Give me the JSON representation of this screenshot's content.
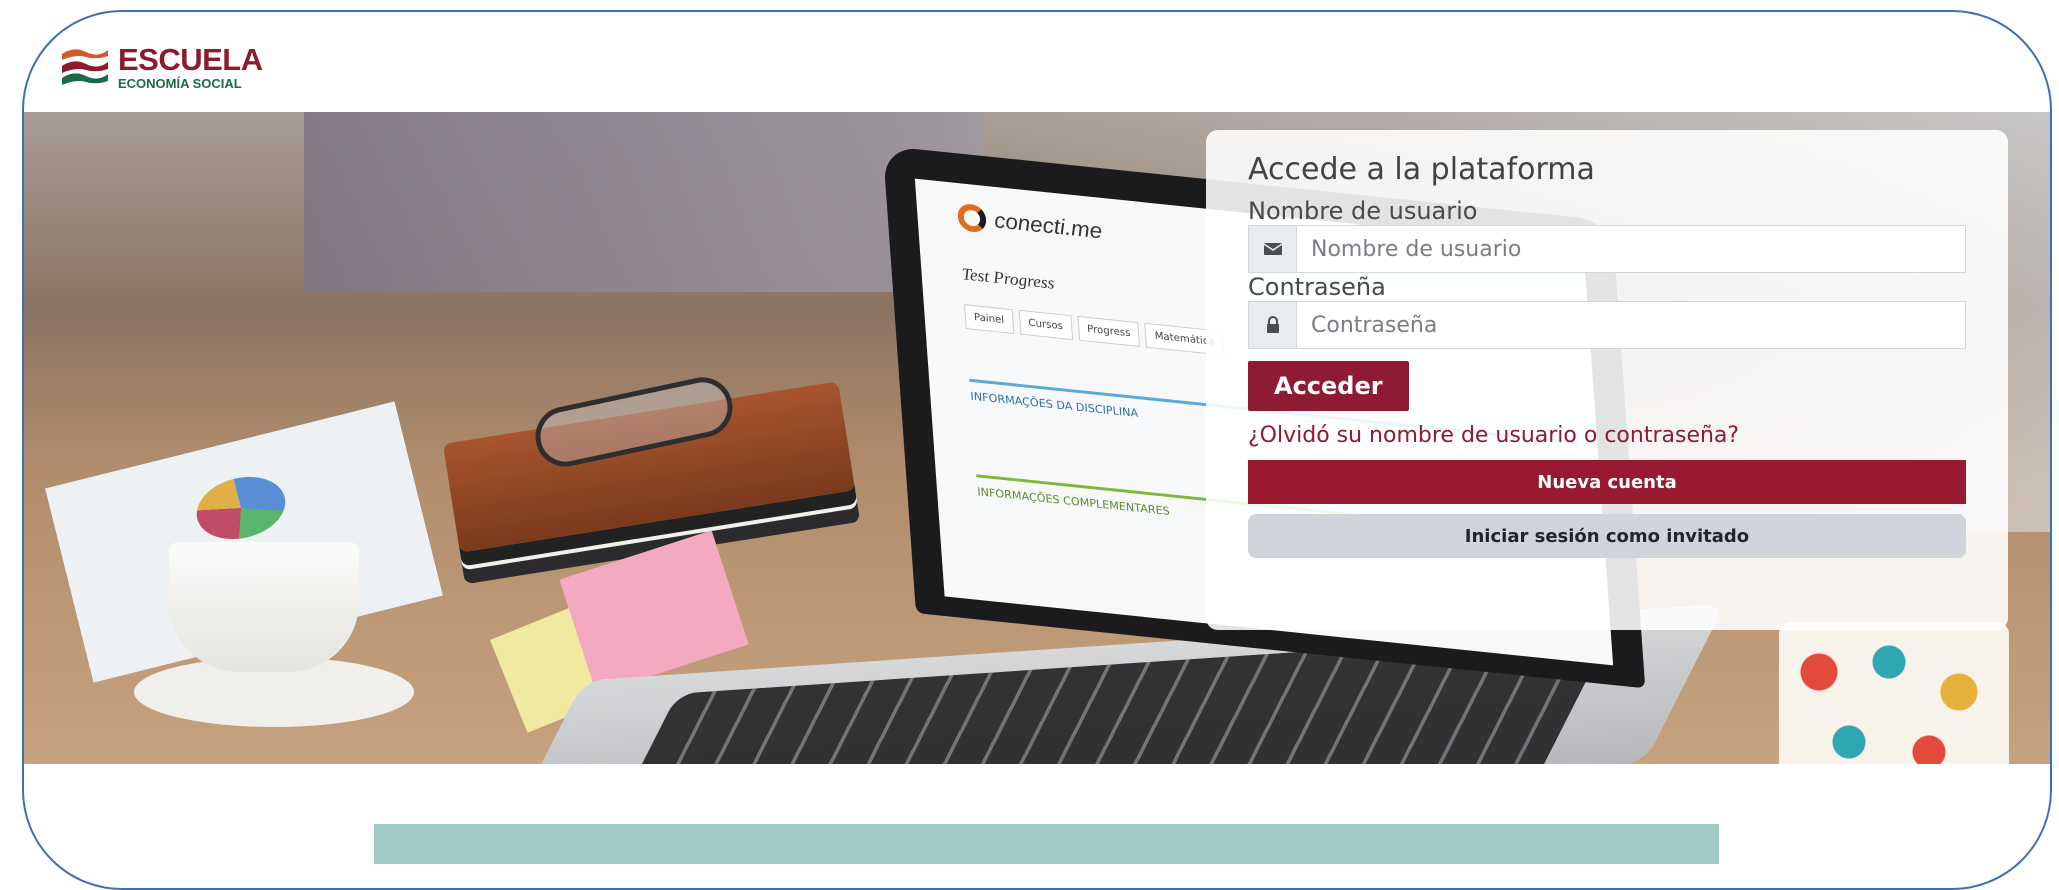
{
  "logo": {
    "title": "ESCUELA",
    "subtitle": "ECONOMÍA SOCIAL",
    "colors": {
      "title": "#8c1c2c",
      "subtitle": "#1e6a46",
      "stripe_top": "#d35a2a",
      "stripe_mid": "#8c1c2c",
      "stripe_bottom": "#1e6a46"
    }
  },
  "hero": {
    "screen": {
      "brand": "conecti.me",
      "title": "Test Progress",
      "tabs": [
        "Painel",
        "Cursos",
        "Progress",
        "Matemática"
      ],
      "section1": "INFORMAÇÕES DA DISCIPLINA",
      "section2": "INFORMAÇÕES COMPLEMENTARES"
    }
  },
  "login": {
    "heading": "Accede a la plataforma",
    "username_label": "Nombre de usuario",
    "username_placeholder": "Nombre de usuario",
    "username_icon": "envelope-icon",
    "password_label": "Contraseña",
    "password_placeholder": "Contraseña",
    "password_icon": "lock-icon",
    "submit_label": "Acceder",
    "forgot_label": "¿Olvidó su nombre de usuario o contraseña?",
    "new_account_label": "Nueva cuenta",
    "guest_label": "Iniciar sesión como invitado"
  },
  "colors": {
    "primary": "#8e1b31",
    "frame_border": "#3b6fb8",
    "guest_button": "#ced4da",
    "footer_bar": "#9fcdc6"
  }
}
